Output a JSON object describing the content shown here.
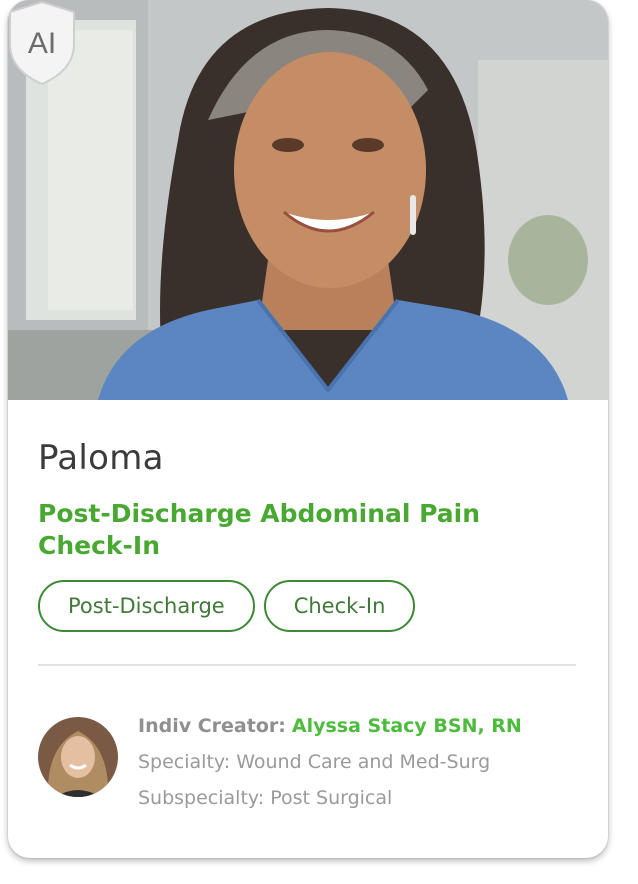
{
  "persona": {
    "name": "Paloma",
    "title": "Post-Discharge Abdominal Pain Check-In",
    "badge_text": "AI",
    "tags": [
      "Post-Discharge",
      "Check-In"
    ]
  },
  "creator": {
    "label": "Indiv Creator:",
    "name": "Alyssa Stacy BSN, RN",
    "specialty": "Specialty: Wound Care and Med-Surg",
    "subspecialty": "Subspecialty: Post Surgical"
  },
  "colors": {
    "accent_green": "#48a832",
    "creator_green": "#4dbb3c",
    "tag_border": "#3c8a35",
    "scrubs_blue": "#5b86c2"
  },
  "icons": {
    "badge": "ai-shield-icon"
  }
}
